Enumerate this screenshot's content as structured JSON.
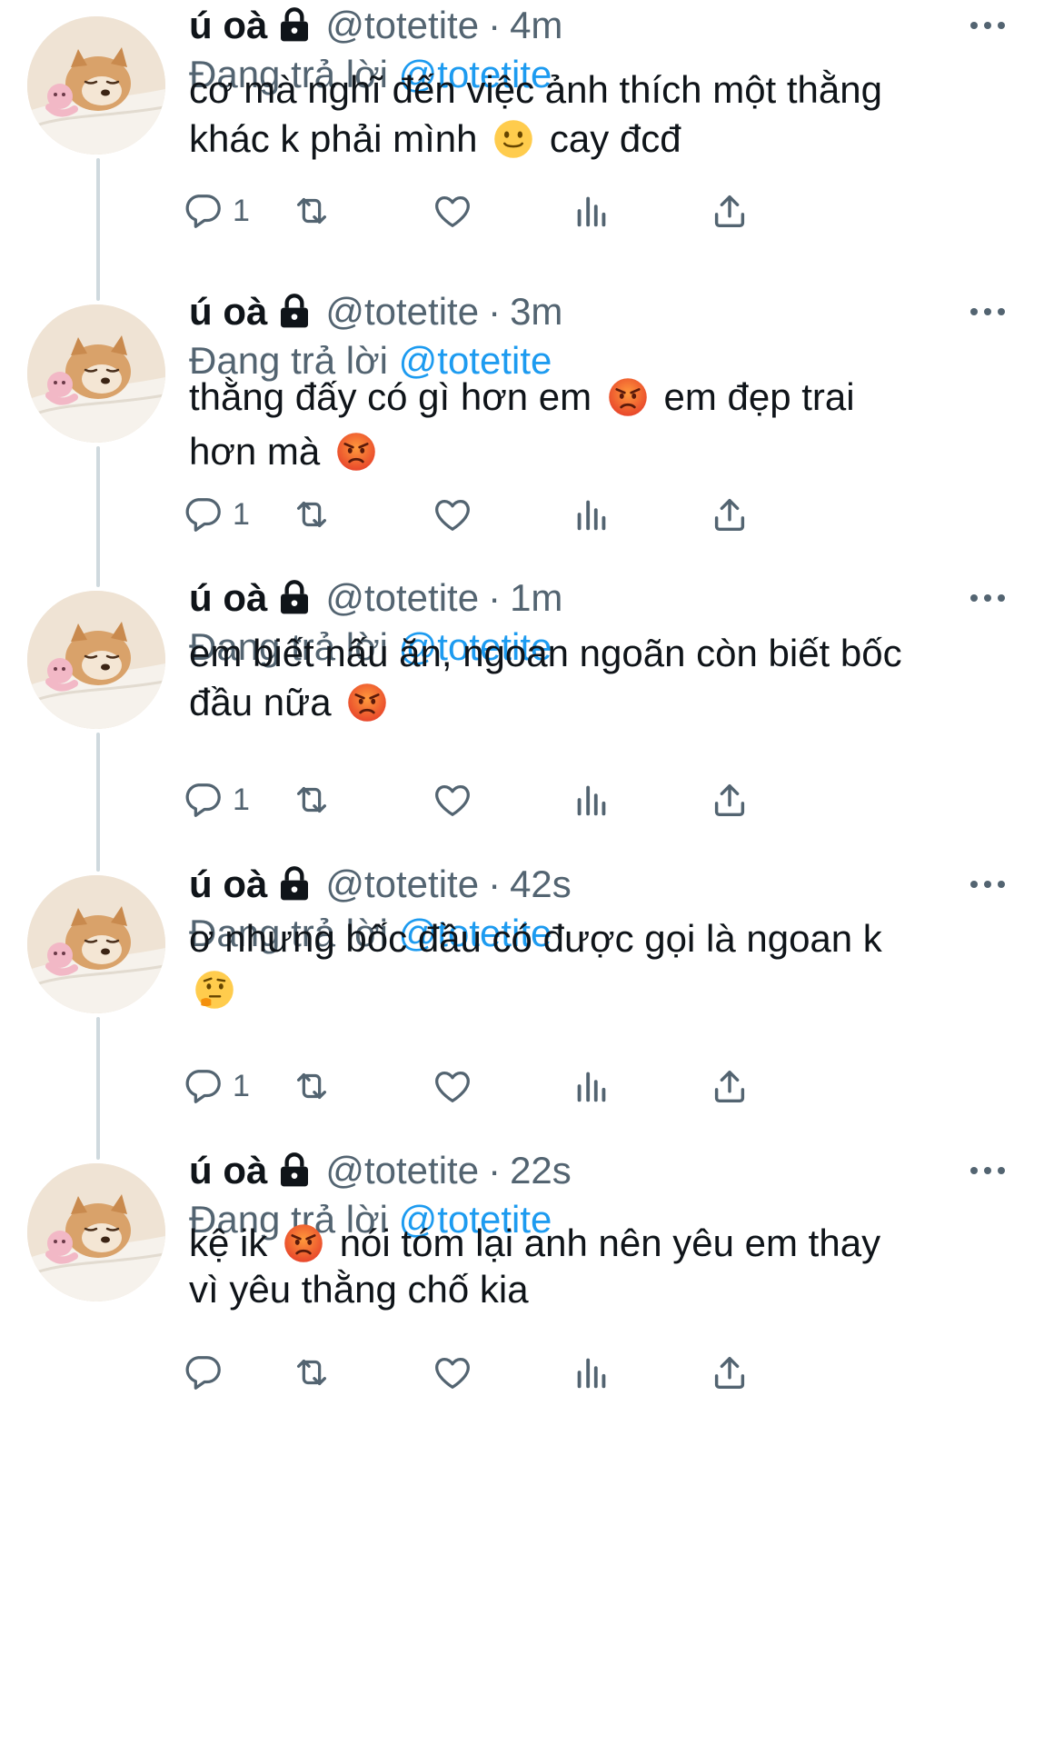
{
  "user": {
    "name": "ú oà",
    "handle": "@totetite",
    "reply_prefix": "Đang trả lời",
    "reply_to": "@totetite"
  },
  "tweets": [
    {
      "time": "4m",
      "lines": [
        [
          {
            "t": "cơ mà nghĩ đến việc ảnh thích một thằng"
          }
        ],
        [
          {
            "t": "khác k phải mình "
          },
          {
            "emoji": "slightly-smiling-face-emoji"
          },
          {
            "t": " cay đcđ"
          }
        ]
      ],
      "reply_count": "1"
    },
    {
      "time": "3m",
      "lines": [
        [
          {
            "t": "thằng đấy có gì hơn em "
          },
          {
            "emoji": "pouting-face-emoji"
          },
          {
            "t": " em đẹp trai"
          }
        ],
        [
          {
            "t": "hơn mà "
          },
          {
            "emoji": "pouting-face-emoji"
          }
        ]
      ],
      "reply_count": "1"
    },
    {
      "time": "1m",
      "lines": [
        [
          {
            "t": "em biết nấu ăn, ngoan ngoãn còn biết bốc"
          }
        ],
        [
          {
            "t": "đầu nữa "
          },
          {
            "emoji": "pouting-face-emoji"
          }
        ]
      ],
      "reply_count": "1"
    },
    {
      "time": "42s",
      "lines": [
        [
          {
            "t": "ơ nhưng bốc đầu có được gọi là ngoan k"
          }
        ],
        [
          {
            "emoji": "thinking-face-emoji"
          }
        ]
      ],
      "reply_count": "1"
    },
    {
      "time": "22s",
      "lines": [
        [
          {
            "t": "kệ ik "
          },
          {
            "emoji": "pouting-face-emoji"
          },
          {
            "t": " nói tóm lại anh nên yêu em thay"
          }
        ],
        [
          {
            "t": "vì yêu thằng chố kia"
          }
        ]
      ],
      "reply_count": ""
    }
  ],
  "icons": {
    "more": "more-options-icon",
    "lock": "lock-icon",
    "reply": "reply-icon",
    "retweet": "retweet-icon",
    "like": "like-icon",
    "views": "views-icon",
    "share": "share-icon"
  },
  "colors": {
    "text": "#0f1419",
    "secondary": "#536471",
    "mention": "#1d9bf0",
    "thread_line": "#cfd9de"
  }
}
